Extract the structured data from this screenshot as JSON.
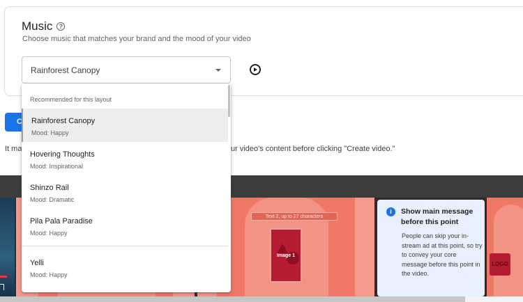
{
  "music": {
    "title": "Music",
    "subtitle": "Choose music that matches your brand and the mood of your video",
    "selected_track": "Rainforest Canopy"
  },
  "create_button_label": "C",
  "hint_left": "It ma",
  "hint_right": "ur video's content before clicking \"Create video.\"",
  "dropdown": {
    "header": "Recommended for this layout",
    "items": [
      {
        "name": "Rainforest Canopy",
        "mood": "Mood: Happy"
      },
      {
        "name": "Hovering Thoughts",
        "mood": "Mood: Inspirational"
      },
      {
        "name": "Shinzo Rail",
        "mood": "Mood: Dramatic"
      },
      {
        "name": "Pila Pala Paradise",
        "mood": "Mood: Happy"
      },
      {
        "name": "Yelli",
        "mood": "Mood: Happy"
      }
    ]
  },
  "preview": {
    "caption": "Text 2, up to 27 characters",
    "image_label": "Image 1",
    "logo_label": "LOGO"
  },
  "info_panel": {
    "icon": "i",
    "title": "Show main message before this point",
    "body": "People can skip your in-stream ad at this point, so try to convey your core message before this point in the video."
  },
  "colors": {
    "accent": "#1a73e8",
    "frame": "#f07868",
    "info_bg": "#e8f0fe",
    "image_box": "#b51b33"
  }
}
